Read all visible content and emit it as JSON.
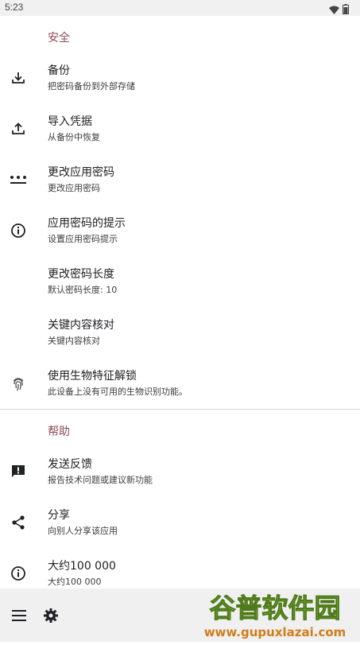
{
  "status_bar": {
    "time": "5:23",
    "wifi_icon": "wifi-icon",
    "battery_icon": "battery-icon"
  },
  "sections": {
    "security": {
      "header": "安全"
    },
    "help": {
      "header": "帮助"
    }
  },
  "security_items": [
    {
      "title": "备份",
      "summary": "把密码备份到外部存储",
      "icon": "download-icon"
    },
    {
      "title": "导入凭据",
      "summary": "从备份中恢复",
      "icon": "upload-icon"
    },
    {
      "title": "更改应用密码",
      "summary": "更改应用密码",
      "icon": "password-dots-icon"
    },
    {
      "title": "应用密码的提示",
      "summary": "设置应用密码提示",
      "icon": "info-icon"
    },
    {
      "title": "更改密码长度",
      "summary": "默认密码长度: 10"
    },
    {
      "title": "关键内容核对",
      "summary": "关键内容核对"
    },
    {
      "title": "使用生物特征解锁",
      "summary": "此设备上没有可用的生物识别功能。",
      "icon": "fingerprint-icon"
    }
  ],
  "help_items": [
    {
      "title": "发送反馈",
      "summary": "报告技术问题或建议新功能",
      "icon": "feedback-icon"
    },
    {
      "title": "分享",
      "summary": "向别人分享该应用",
      "icon": "share-icon"
    },
    {
      "title": "大约100 000",
      "summary": "大约100 000",
      "icon": "info-icon"
    }
  ],
  "bottom_bar": {
    "menu_icon": "menu-icon",
    "settings_icon": "gear-icon"
  },
  "watermark": {
    "brand": "谷普软件园",
    "url": "www.gupuxlazai.com"
  },
  "colors": {
    "accent": "#8d4b57",
    "bottom_bar": "#f0f0f0",
    "status_bar": "#f1f1f1"
  }
}
